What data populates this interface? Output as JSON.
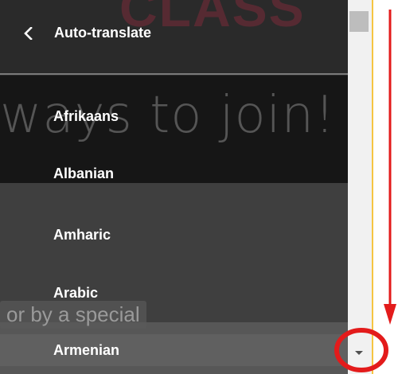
{
  "background": {
    "logo_text": "CLASS",
    "script_text": "ways to join!",
    "caption_text": "or by a special"
  },
  "menu": {
    "title": "Auto-translate",
    "back_icon": "chevron-left-icon",
    "languages": [
      {
        "label": "Afrikaans"
      },
      {
        "label": "Albanian"
      },
      {
        "label": "Amharic"
      },
      {
        "label": "Arabic"
      },
      {
        "label": "Armenian"
      }
    ]
  },
  "scrollbar": {
    "down_arrow_icon": "triangle-down-icon"
  },
  "annotations": {
    "arrow_color": "#e31b1b",
    "circle_color": "#e31b1b"
  },
  "colors": {
    "text": "#ffffff",
    "highlight": "#f5c542"
  }
}
